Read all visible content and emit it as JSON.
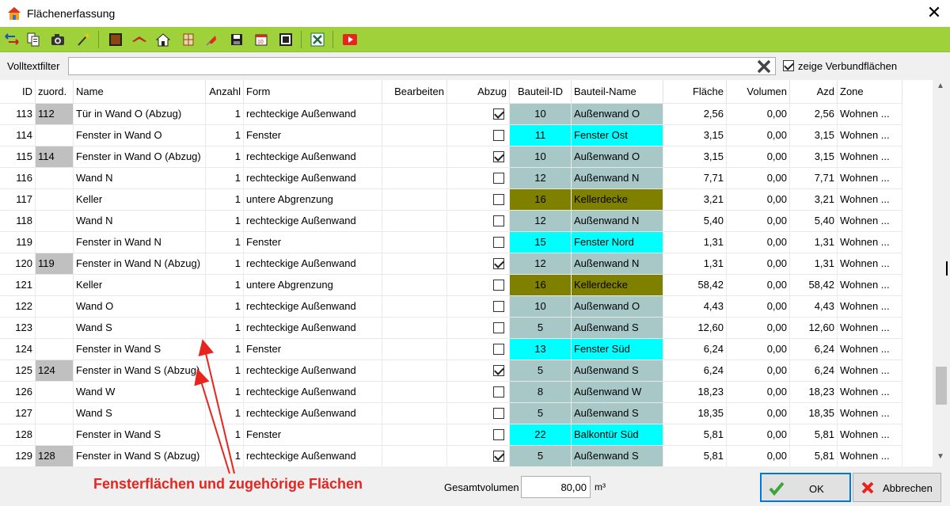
{
  "window": {
    "title": "Flächenerfassung"
  },
  "filter": {
    "label": "Volltextfilter",
    "value": "",
    "show_composite_label": "zeige Verbundflächen",
    "show_composite_checked": true
  },
  "columns": [
    "ID",
    "zuord.",
    "Name",
    "Anzahl",
    "Form",
    "Bearbeiten",
    "Abzug",
    "Bauteil-ID",
    "Bauteil-Name",
    "Fläche",
    "Volumen",
    "Azd",
    "Zone"
  ],
  "rows": [
    {
      "id": "113",
      "zuord": "112",
      "name": "Tür in Wand O (Abzug)",
      "anzahl": "1",
      "form": "rechteckige Außenwand",
      "abzug": true,
      "bid": "10",
      "bname": "Außenwand O",
      "color": "teal",
      "flaeche": "2,56",
      "volumen": "0,00",
      "azd": "2,56",
      "zone": "Wohnen ..."
    },
    {
      "id": "114",
      "zuord": "",
      "name": "Fenster in Wand O",
      "anzahl": "1",
      "form": "Fenster",
      "abzug": false,
      "bid": "11",
      "bname": "Fenster Ost",
      "color": "cyan",
      "flaeche": "3,15",
      "volumen": "0,00",
      "azd": "3,15",
      "zone": "Wohnen ..."
    },
    {
      "id": "115",
      "zuord": "114",
      "name": "Fenster in Wand O (Abzug)",
      "anzahl": "1",
      "form": "rechteckige Außenwand",
      "abzug": true,
      "bid": "10",
      "bname": "Außenwand O",
      "color": "teal",
      "flaeche": "3,15",
      "volumen": "0,00",
      "azd": "3,15",
      "zone": "Wohnen ..."
    },
    {
      "id": "116",
      "zuord": "",
      "name": "Wand N",
      "anzahl": "1",
      "form": "rechteckige Außenwand",
      "abzug": false,
      "bid": "12",
      "bname": "Außenwand N",
      "color": "teal",
      "flaeche": "7,71",
      "volumen": "0,00",
      "azd": "7,71",
      "zone": "Wohnen ..."
    },
    {
      "id": "117",
      "zuord": "",
      "name": "Keller",
      "anzahl": "1",
      "form": "untere Abgrenzung",
      "abzug": false,
      "bid": "16",
      "bname": "Kellerdecke",
      "color": "olive",
      "flaeche": "3,21",
      "volumen": "0,00",
      "azd": "3,21",
      "zone": "Wohnen ..."
    },
    {
      "id": "118",
      "zuord": "",
      "name": "Wand N",
      "anzahl": "1",
      "form": "rechteckige Außenwand",
      "abzug": false,
      "bid": "12",
      "bname": "Außenwand N",
      "color": "teal",
      "flaeche": "5,40",
      "volumen": "0,00",
      "azd": "5,40",
      "zone": "Wohnen ..."
    },
    {
      "id": "119",
      "zuord": "",
      "name": "Fenster in Wand N",
      "anzahl": "1",
      "form": "Fenster",
      "abzug": false,
      "bid": "15",
      "bname": "Fenster Nord",
      "color": "cyan",
      "flaeche": "1,31",
      "volumen": "0,00",
      "azd": "1,31",
      "zone": "Wohnen ..."
    },
    {
      "id": "120",
      "zuord": "119",
      "name": "Fenster in Wand N (Abzug)",
      "anzahl": "1",
      "form": "rechteckige Außenwand",
      "abzug": true,
      "bid": "12",
      "bname": "Außenwand N",
      "color": "teal",
      "flaeche": "1,31",
      "volumen": "0,00",
      "azd": "1,31",
      "zone": "Wohnen ..."
    },
    {
      "id": "121",
      "zuord": "",
      "name": "Keller",
      "anzahl": "1",
      "form": "untere Abgrenzung",
      "abzug": false,
      "bid": "16",
      "bname": "Kellerdecke",
      "color": "olive",
      "flaeche": "58,42",
      "volumen": "0,00",
      "azd": "58,42",
      "zone": "Wohnen ..."
    },
    {
      "id": "122",
      "zuord": "",
      "name": "Wand O",
      "anzahl": "1",
      "form": "rechteckige Außenwand",
      "abzug": false,
      "bid": "10",
      "bname": "Außenwand O",
      "color": "teal",
      "flaeche": "4,43",
      "volumen": "0,00",
      "azd": "4,43",
      "zone": "Wohnen ..."
    },
    {
      "id": "123",
      "zuord": "",
      "name": "Wand S",
      "anzahl": "1",
      "form": "rechteckige Außenwand",
      "abzug": false,
      "bid": "5",
      "bname": "Außenwand S",
      "color": "teal",
      "flaeche": "12,60",
      "volumen": "0,00",
      "azd": "12,60",
      "zone": "Wohnen ..."
    },
    {
      "id": "124",
      "zuord": "",
      "name": "Fenster in Wand S",
      "anzahl": "1",
      "form": "Fenster",
      "abzug": false,
      "bid": "13",
      "bname": "Fenster Süd",
      "color": "cyan",
      "flaeche": "6,24",
      "volumen": "0,00",
      "azd": "6,24",
      "zone": "Wohnen ..."
    },
    {
      "id": "125",
      "zuord": "124",
      "name": "Fenster in Wand S (Abzug)",
      "anzahl": "1",
      "form": "rechteckige Außenwand",
      "abzug": true,
      "bid": "5",
      "bname": "Außenwand S",
      "color": "teal",
      "flaeche": "6,24",
      "volumen": "0,00",
      "azd": "6,24",
      "zone": "Wohnen ..."
    },
    {
      "id": "126",
      "zuord": "",
      "name": "Wand W",
      "anzahl": "1",
      "form": "rechteckige Außenwand",
      "abzug": false,
      "bid": "8",
      "bname": "Außenwand W",
      "color": "teal",
      "flaeche": "18,23",
      "volumen": "0,00",
      "azd": "18,23",
      "zone": "Wohnen ..."
    },
    {
      "id": "127",
      "zuord": "",
      "name": "Wand S",
      "anzahl": "1",
      "form": "rechteckige Außenwand",
      "abzug": false,
      "bid": "5",
      "bname": "Außenwand S",
      "color": "teal",
      "flaeche": "18,35",
      "volumen": "0,00",
      "azd": "18,35",
      "zone": "Wohnen ..."
    },
    {
      "id": "128",
      "zuord": "",
      "name": "Fenster in Wand S",
      "anzahl": "1",
      "form": "Fenster",
      "abzug": false,
      "bid": "22",
      "bname": "Balkontür Süd",
      "color": "cyan",
      "flaeche": "5,81",
      "volumen": "0,00",
      "azd": "5,81",
      "zone": "Wohnen ..."
    },
    {
      "id": "129",
      "zuord": "128",
      "name": "Fenster in Wand S (Abzug)",
      "anzahl": "1",
      "form": "rechteckige Außenwand",
      "abzug": true,
      "bid": "5",
      "bname": "Außenwand S",
      "color": "teal",
      "flaeche": "5,81",
      "volumen": "0,00",
      "azd": "5,81",
      "zone": "Wohnen ..."
    }
  ],
  "annotation": {
    "text": "Fensterflächen und zugehörige Flächen",
    "color": "#e8241e"
  },
  "footer": {
    "total_volume_label": "Gesamtvolumen",
    "total_volume_value": "80,00",
    "unit": "m³",
    "ok_label": "OK",
    "cancel_label": "Abbrechen"
  },
  "toolbar_icons": [
    "sort-icon",
    "copy-icon",
    "camera-icon",
    "wand-icon",
    "wall-icon",
    "roof-icon",
    "house-icon",
    "window-icon",
    "flag-icon",
    "save-icon",
    "calendar-icon",
    "frame-icon",
    "excel-icon",
    "play-icon"
  ],
  "colors": {
    "toolbar": "#9fd13a",
    "teal": "#a8c8c8",
    "cyan": "#00ffff",
    "olive": "#808000",
    "zuord_gray": "#c0c0c0"
  }
}
